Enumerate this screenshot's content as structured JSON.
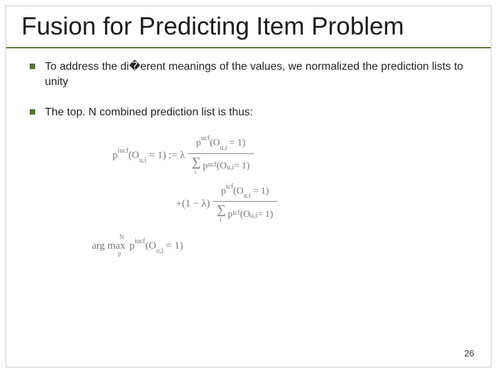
{
  "title": "Fusion for Predicting Item Problem",
  "bullets": [
    "To address the di�erent meanings of the values, we normalized the prediction lists to unity",
    "The top. N combined prediction list is thus:"
  ],
  "formula": {
    "lhs": "p",
    "lhs_sup": "iucf",
    "arg": "(O",
    "arg_sub": "u,i",
    "arg_tail": " = 1) := λ",
    "num1": "p",
    "num1_sup": "ucf",
    "num1_arg": "(O",
    "num1_sub": "u,i",
    "num1_tail": " = 1)",
    "den1_pre": "p",
    "den1_sup": "ucf",
    "den1_arg": "(O",
    "den1_sub": "u,i",
    "den1_tail": " = 1)",
    "row2_pre": "+(1 − λ)",
    "num2": "p",
    "num2_sup": "icf",
    "num2_arg": "(O",
    "num2_sub": "u,i",
    "num2_tail": " = 1)",
    "den2_pre": "p",
    "den2_sup": "icf",
    "den2_arg": "(O",
    "den2_sub": "u,i",
    "den2_tail": " = 1)",
    "row3_pre": "arg max",
    "row3_sup": "N",
    "row3_sub": "p",
    "row3_mid": " p",
    "row3_midsup": "iucf",
    "row3_arg": "(O",
    "row3_argsub": "u,i",
    "row3_tail": " = 1)",
    "sigma_sub": "i"
  },
  "page_number": "26"
}
